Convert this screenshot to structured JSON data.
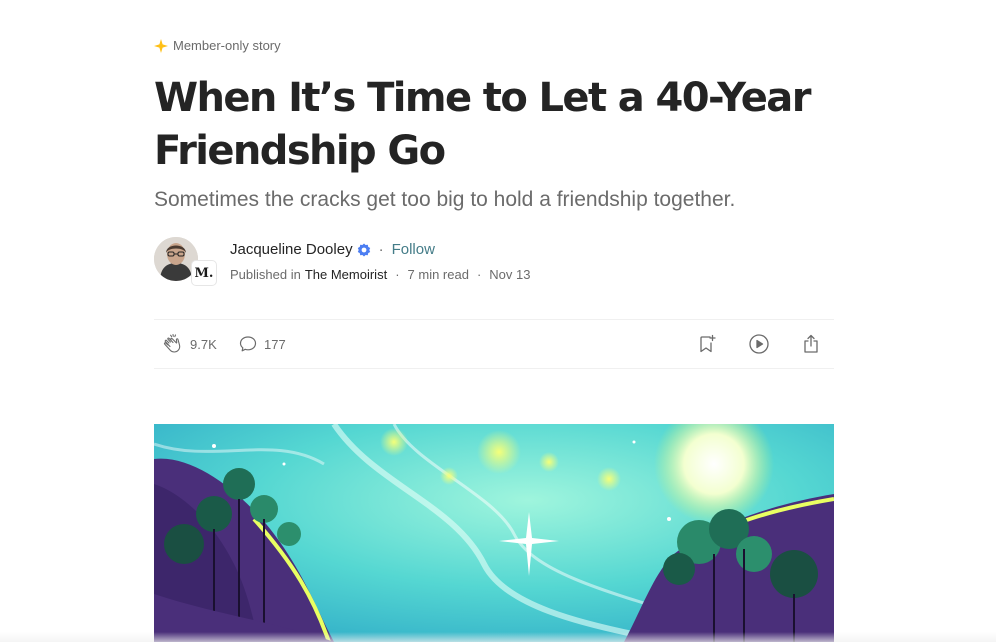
{
  "story": {
    "member_label": "Member-only story",
    "title": "When It’s Time to Let a 40-Year Friendship Go",
    "subtitle": "Sometimes the cracks get too big to hold a friendship together."
  },
  "author": {
    "name": "Jacqueline Dooley",
    "follow_label": "Follow",
    "published_in_label": "Published in",
    "publication": "The Memoirist",
    "publication_badge": "M.",
    "read_time": "7 min read",
    "date": "Nov 13"
  },
  "actions": {
    "claps": "9.7K",
    "responses": "177"
  },
  "icons": {
    "member": "sparkle-star-icon",
    "verified": "verified-badge-icon",
    "clap": "clap-hands-icon",
    "response": "speech-bubble-icon",
    "bookmark": "bookmark-add-icon",
    "listen": "play-circle-icon",
    "share": "share-icon"
  },
  "colors": {
    "accent_star": "#ffc017",
    "verified": "#4c7ef2",
    "follow": "#447c88",
    "text": "#242424",
    "muted": "#6b6b6b"
  }
}
